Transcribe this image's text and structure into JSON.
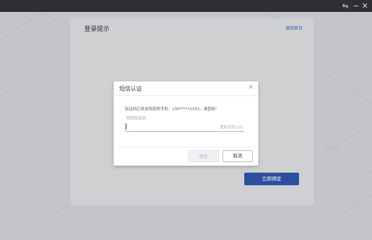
{
  "window": {
    "controls": {
      "swap_icon": "⇋",
      "minimize_icon": "−",
      "close_icon": "✕"
    }
  },
  "card": {
    "title": "登录提示",
    "back_link": "返回首页",
    "bind_button": "立即绑定"
  },
  "dialog": {
    "title": "短信认证",
    "close_icon": "✕",
    "message": "验证码已发送到您的手机：130*****2333，请查收！",
    "code_label": "短信验证码",
    "code_value": "",
    "resend": "重新获取(58)",
    "confirm_label": "确定",
    "cancel_label": "取消"
  },
  "colors": {
    "titlebar": "#2e2f33",
    "accent": "#2d4fa0",
    "link": "#2e5cb8"
  }
}
